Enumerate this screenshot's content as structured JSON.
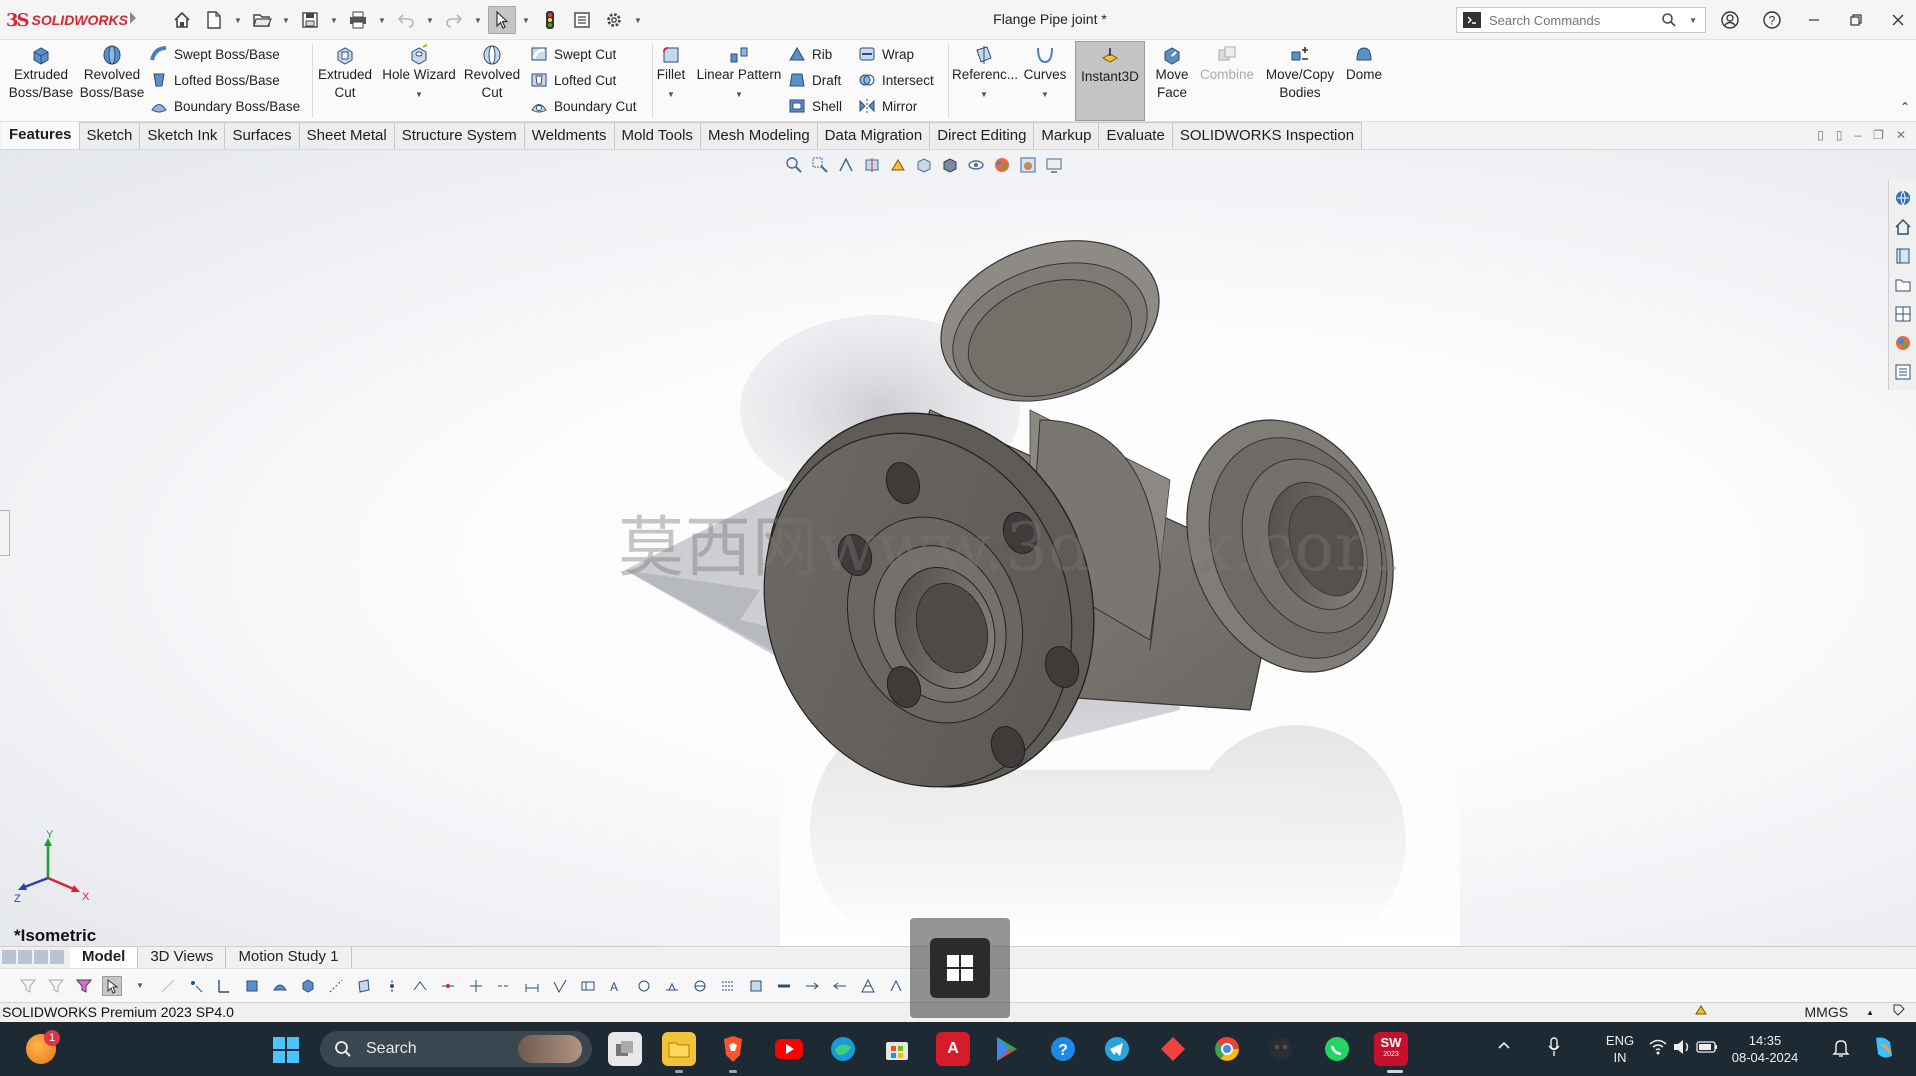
{
  "app": {
    "brand_ds": "3S",
    "brand": "SOLIDWORKS",
    "document_title": "Flange Pipe joint *",
    "search": {
      "placeholder": "Search Commands",
      "value": ""
    }
  },
  "ribbon": {
    "big": [
      {
        "id": "extruded-boss",
        "line1": "Extruded",
        "line2": "Boss/Base"
      },
      {
        "id": "revolved-boss",
        "line1": "Revolved",
        "line2": "Boss/Base"
      },
      {
        "id": "extruded-cut",
        "line1": "Extruded",
        "line2": "Cut"
      },
      {
        "id": "hole-wizard",
        "line1": "Hole Wizard",
        "line2": ""
      },
      {
        "id": "revolved-cut",
        "line1": "Revolved",
        "line2": "Cut"
      },
      {
        "id": "fillet",
        "line1": "Fillet",
        "line2": ""
      },
      {
        "id": "linear-pattern",
        "line1": "Linear Pattern",
        "line2": ""
      },
      {
        "id": "reference",
        "line1": "Referenc...",
        "line2": ""
      },
      {
        "id": "curves",
        "line1": "Curves",
        "line2": ""
      },
      {
        "id": "instant3d",
        "line1": "Instant3D",
        "line2": ""
      },
      {
        "id": "move-face",
        "line1": "Move",
        "line2": "Face"
      },
      {
        "id": "combine",
        "line1": "Combine",
        "line2": ""
      },
      {
        "id": "move-copy",
        "line1": "Move/Copy",
        "line2": "Bodies"
      },
      {
        "id": "dome",
        "line1": "Dome",
        "line2": ""
      }
    ],
    "small": {
      "swept_boss": "Swept Boss/Base",
      "lofted_boss": "Lofted Boss/Base",
      "boundary_boss": "Boundary Boss/Base",
      "swept_cut": "Swept Cut",
      "lofted_cut": "Lofted Cut",
      "boundary_cut": "Boundary Cut",
      "rib": "Rib",
      "draft": "Draft",
      "shell": "Shell",
      "wrap": "Wrap",
      "intersect": "Intersect",
      "mirror": "Mirror"
    }
  },
  "tabs": [
    "Features",
    "Sketch",
    "Sketch Ink",
    "Surfaces",
    "Sheet Metal",
    "Structure System",
    "Weldments",
    "Mold Tools",
    "Mesh Modeling",
    "Data Migration",
    "Direct Editing",
    "Markup",
    "Evaluate",
    "SOLIDWORKS Inspection"
  ],
  "viewport": {
    "watermark": "莫西网www.3dmox.com",
    "view_name": "*Isometric",
    "triad": {
      "x": "X",
      "y": "Y",
      "z": "Z"
    }
  },
  "model_tabs": [
    "Model",
    "3D Views",
    "Motion Study 1"
  ],
  "status": {
    "text": "SOLIDWORKS Premium 2023 SP4.0",
    "units": "MMGS"
  },
  "taskbar": {
    "notification_count": "1",
    "search": "Search",
    "language_line1": "ENG",
    "language_line2": "IN",
    "time": "14:35",
    "date": "08-04-2024",
    "sw_badge": "SW",
    "sw_year": "2023"
  },
  "colors": {
    "brand_red": "#d8262e",
    "taskbar_bg": "#1e2a33",
    "model_metal": "#7d7a76"
  }
}
